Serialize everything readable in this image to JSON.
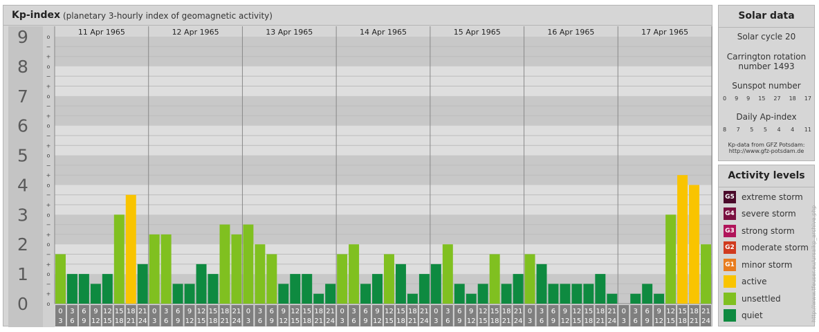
{
  "header": {
    "title": "Kp-index",
    "subtitle": "(planetary 3-hourly index of geomagnetic activity)"
  },
  "chart_data": {
    "type": "bar",
    "ylim": [
      0,
      9
    ],
    "y_ticks": [
      "0",
      "1",
      "2",
      "3",
      "4",
      "5",
      "6",
      "7",
      "8",
      "9"
    ],
    "sub_ticks": [
      "o",
      "+",
      "−"
    ],
    "days": [
      "11 Apr 1965",
      "12 Apr 1965",
      "13 Apr 1965",
      "14 Apr 1965",
      "15 Apr 1965",
      "16 Apr 1965",
      "17 Apr 1965"
    ],
    "hour_start_labels": [
      "0",
      "3",
      "6",
      "9",
      "12",
      "15",
      "18",
      "21"
    ],
    "hour_end_labels": [
      "3",
      "6",
      "9",
      "12",
      "15",
      "18",
      "21",
      "24"
    ],
    "values": [
      [
        1.667,
        1.0,
        1.0,
        0.667,
        1.0,
        3.0,
        3.667,
        1.333
      ],
      [
        2.333,
        2.333,
        0.667,
        0.667,
        1.333,
        1.0,
        2.667,
        2.333
      ],
      [
        2.667,
        2.0,
        1.667,
        0.667,
        1.0,
        1.0,
        0.333,
        0.667
      ],
      [
        1.667,
        2.0,
        0.667,
        1.0,
        1.667,
        1.333,
        0.333,
        1.0
      ],
      [
        1.333,
        2.0,
        0.667,
        0.333,
        0.667,
        1.667,
        0.667,
        1.0
      ],
      [
        1.667,
        1.333,
        0.667,
        0.667,
        0.667,
        0.667,
        1.0,
        0.333
      ],
      [
        0.0,
        0.333,
        0.667,
        0.333,
        3.0,
        4.333,
        4.0,
        2.0
      ]
    ]
  },
  "solar": {
    "title": "Solar data",
    "cycle": "Solar cycle 20",
    "carrington_l1": "Carrington rotation",
    "carrington_l2": "number 1493",
    "sunspot_title": "Sunspot number",
    "sunspot_values": [
      "0",
      "9",
      "9",
      "15",
      "27",
      "18",
      "17"
    ],
    "ap_title": "Daily Ap-index",
    "ap_values": [
      "8",
      "7",
      "5",
      "5",
      "4",
      "4",
      "11"
    ],
    "credit_l1": "Kp-data from GFZ Potsdam:",
    "credit_l2": "http://www.gfz-potsdam.de"
  },
  "activity": {
    "title": "Activity levels",
    "items": [
      {
        "code": "G5",
        "label": "extreme storm",
        "color": "#4a0a2a"
      },
      {
        "code": "G4",
        "label": "severe storm",
        "color": "#7a1040"
      },
      {
        "code": "G3",
        "label": "strong storm",
        "color": "#b0145a"
      },
      {
        "code": "G2",
        "label": "moderate storm",
        "color": "#d03a1e"
      },
      {
        "code": "G1",
        "label": "minor storm",
        "color": "#e87c1e"
      },
      {
        "code": "",
        "label": "active",
        "color": "#f9c400"
      },
      {
        "code": "",
        "label": "unsettled",
        "color": "#80c020"
      },
      {
        "code": "",
        "label": "quiet",
        "color": "#0e8a40"
      }
    ]
  },
  "colors": {
    "quiet": "#0e8a40",
    "unsettled": "#80c020",
    "active": "#f9c400"
  },
  "watermark": "http://www.tfeuser.eu/ursaikp_archive.php"
}
